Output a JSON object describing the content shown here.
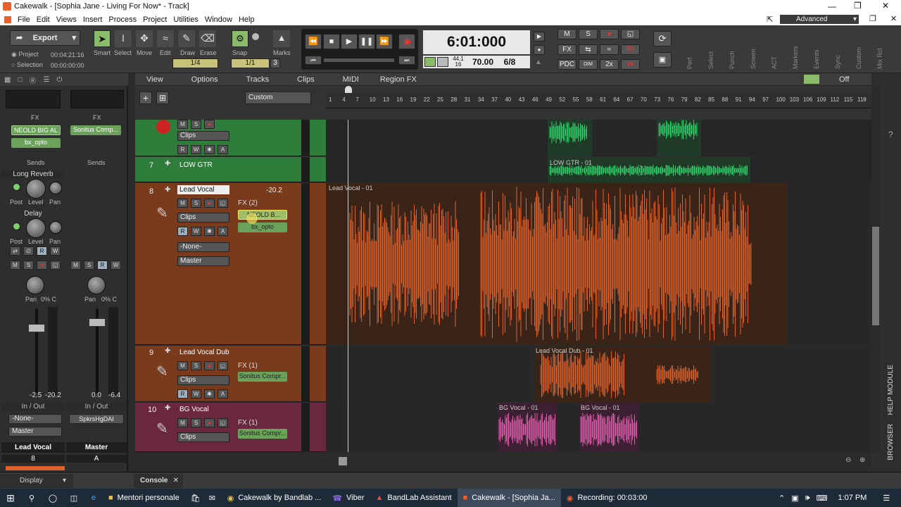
{
  "window": {
    "title": "Cakewalk - [Sophia Jane - Living For Now* - Track]"
  },
  "menu": [
    "File",
    "Edit",
    "Views",
    "Insert",
    "Process",
    "Project",
    "Utilities",
    "Window",
    "Help"
  ],
  "workspace": "Advanced",
  "control": {
    "export_label": "Export",
    "project_label": "Project",
    "project_time": "00:04:21:16",
    "selection_label": "Selection",
    "selection_time": "00:00:00:00",
    "tools": [
      "Smart",
      "Select",
      "Move",
      "Edit",
      "Draw",
      "Erase"
    ],
    "snap_label": "Snap",
    "snap_value": "1/4",
    "marks_label": "Marks",
    "marks_value": "1/1",
    "marks_num": "3",
    "time_display": "6:01:000",
    "sample_rate": "44.1",
    "bit_depth": "16",
    "tempo": "70.00",
    "meter": "6/8",
    "mix_buttons": [
      "M",
      "S",
      "",
      "",
      "FX",
      "",
      "",
      "RI",
      "PDC",
      "DIM",
      "2x",
      "W"
    ],
    "modules": [
      "Perf",
      "Select",
      "Punch",
      "Screen",
      "ACT",
      "Markers",
      "Events",
      "Sync",
      "Custom",
      "Mix Rcl"
    ]
  },
  "inspector": {
    "fx_label": "FX",
    "strip1": {
      "fx": [
        "NEOLD BIG AL",
        "bx_opto"
      ],
      "sends_label": "Sends",
      "send1": "Long Reverb",
      "send2": "Delay",
      "knob_labels": [
        "Post",
        "Level",
        "Pan"
      ],
      "pan_label": "Pan",
      "pan_value": "0% C",
      "vol": "-2.5",
      "peak": "-20.2",
      "io_label": "In / Out",
      "input": "-None-",
      "output": "Master",
      "name": "Lead Vocal",
      "number": "8"
    },
    "strip2": {
      "fx": [
        "Sonitus Comp..."
      ],
      "sends_label": "Sends",
      "pan_label": "Pan",
      "pan_value": "0% C",
      "vol": "0.0",
      "peak": "-6.4",
      "io_label": "In / Out",
      "output": "SpkrsHgDAI",
      "name": "Master",
      "number": "A"
    }
  },
  "trackview": {
    "menus": [
      "View",
      "Options",
      "Tracks",
      "Clips",
      "MIDI",
      "Region FX"
    ],
    "preset": "Custom",
    "off_label": "Off",
    "ruler_ticks": [
      "1",
      "4",
      "7",
      "10",
      "13",
      "16",
      "19",
      "22",
      "25",
      "28",
      "31",
      "34",
      "37",
      "40",
      "43",
      "46",
      "49",
      "52",
      "55",
      "58",
      "61",
      "64",
      "67",
      "70",
      "73",
      "76",
      "79",
      "82",
      "85",
      "88",
      "91",
      "94",
      "97",
      "100",
      "103",
      "106",
      "109",
      "112",
      "115",
      "118"
    ],
    "clips_label": "Clips",
    "input_none": "-None-",
    "output_master": "Master"
  },
  "tracks": [
    {
      "num": "",
      "name": "",
      "clips": []
    },
    {
      "num": "7",
      "name": "LOW GTR",
      "clip": "LOW GTR - 01"
    },
    {
      "num": "8",
      "name": "Lead Vocal",
      "vol": "-20.2",
      "fx": "FX (2)",
      "fx_slots": [
        "NEOLD B...",
        "bx_opto"
      ],
      "clip": "Lead Vocal - 01"
    },
    {
      "num": "9",
      "name": "Lead Vocal Dub",
      "fx": "FX (1)",
      "fx_slots": [
        "Sonitus Compr..."
      ],
      "clip": "Lead Vocal Dub - 01"
    },
    {
      "num": "10",
      "name": "BG Vocal",
      "fx": "FX (1)",
      "fx_slots": [
        "Sonitus Compr..."
      ],
      "clip1": "BG Vocal - 01",
      "clip2": "BG Vocal - 01"
    }
  ],
  "bottom": {
    "display": "Display",
    "console": "Console",
    "browser": "BROWSER",
    "help": "HELP MODULE"
  },
  "taskbar": {
    "items": [
      "Mentori personale",
      "Cakewalk by Bandlab ...",
      "Viber",
      "BandLab Assistant",
      "Cakewalk - [Sophia Ja...",
      "Recording:  00:03:00"
    ],
    "time": "1:07 PM"
  },
  "colors": {
    "track_green": "#2e7d3a",
    "track_orange": "#7a3a1c",
    "track_pink": "#6a2840",
    "wave_orange": "#e0612a",
    "wave_green": "#2fd46a",
    "wave_pink": "#e060b0",
    "accent_yellow": "#f0e060"
  }
}
